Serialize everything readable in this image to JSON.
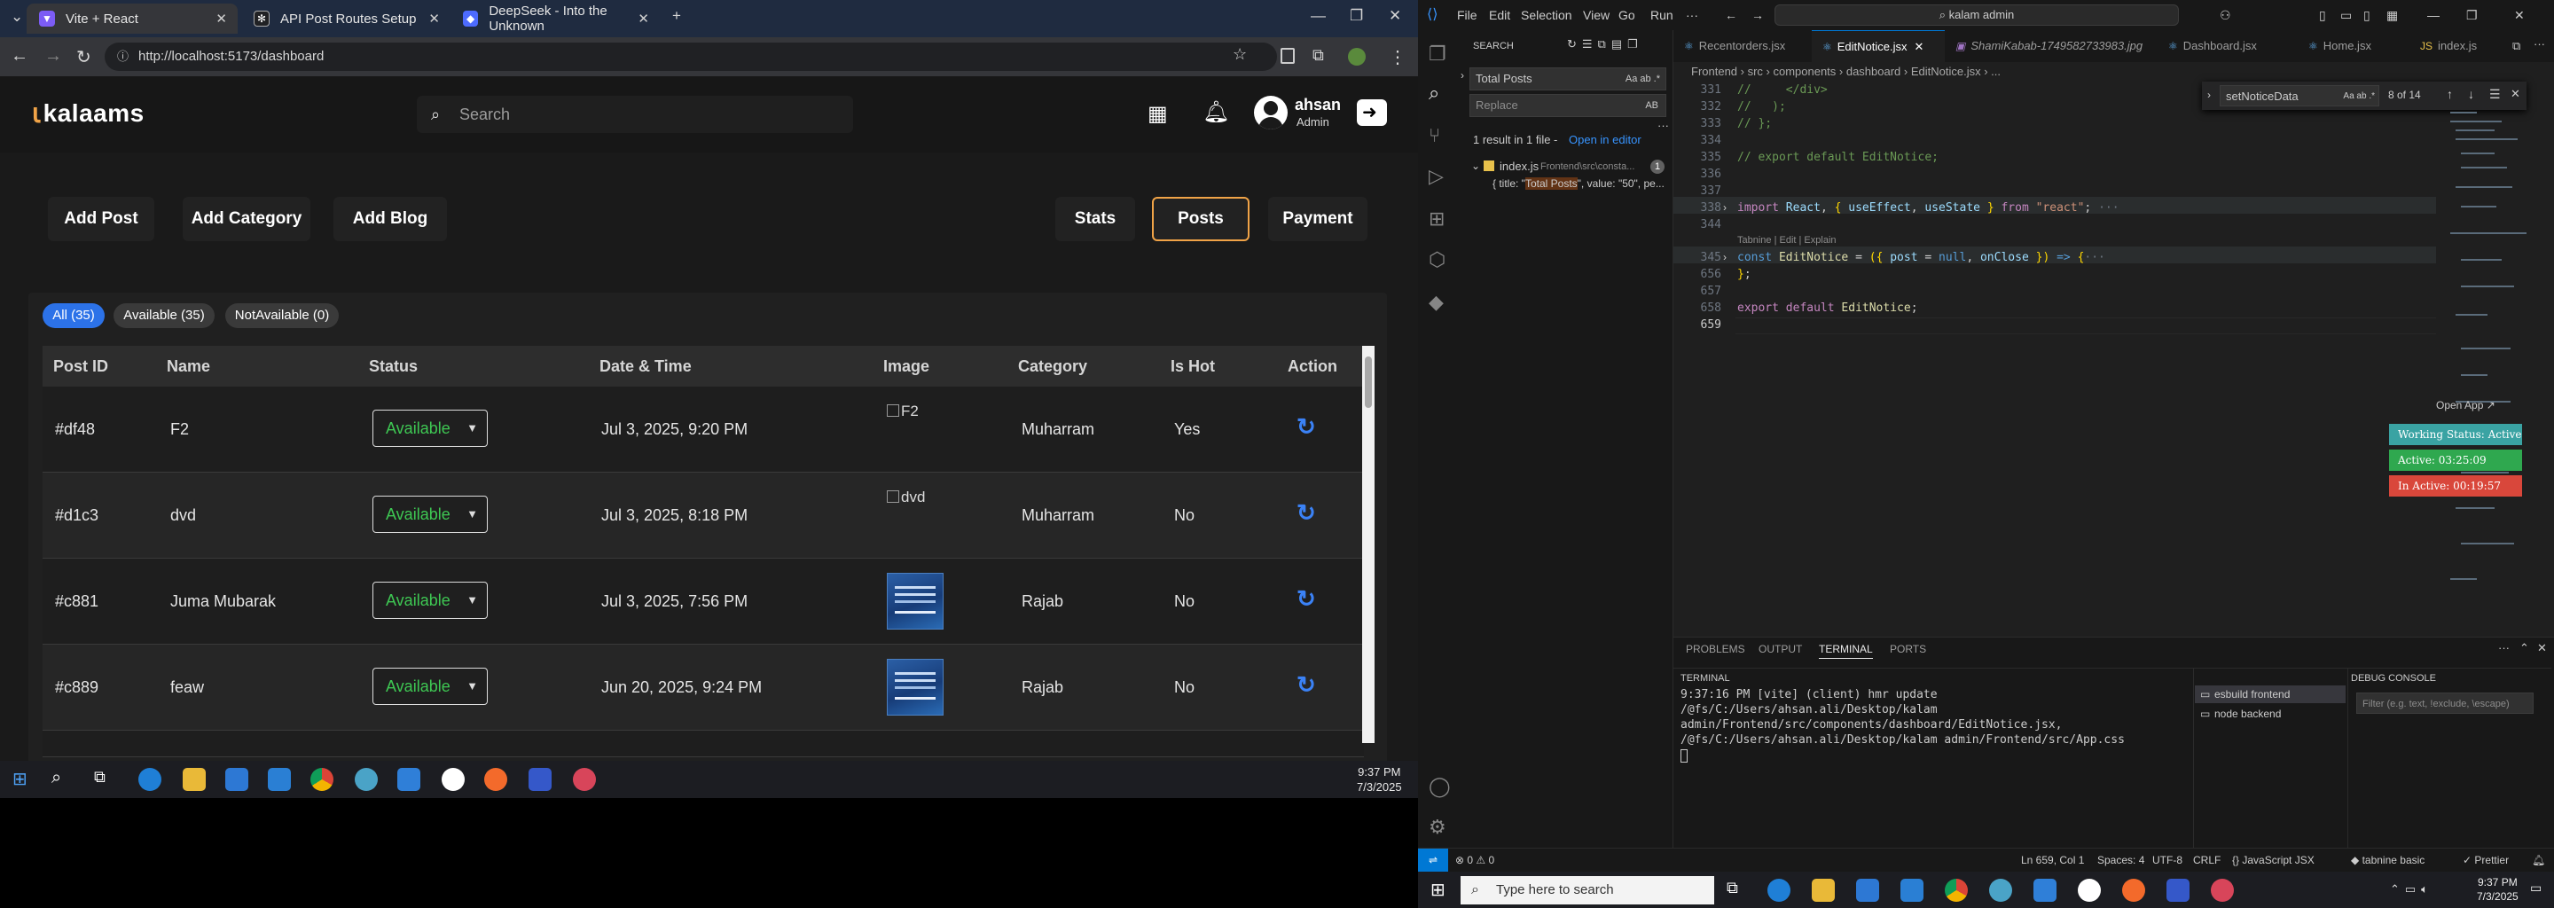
{
  "browser": {
    "tabs": [
      {
        "label": "Vite + React",
        "active": true
      },
      {
        "label": "API Post Routes Setup",
        "active": false
      },
      {
        "label": "DeepSeek - Into the Unknown",
        "active": false
      }
    ],
    "url": "http://localhost:5173/dashboard"
  },
  "app": {
    "logo": "kalaams",
    "search_placeholder": "Search",
    "user": {
      "name": "ahsan",
      "role": "Admin"
    },
    "actions": [
      "Add Post",
      "Add Category",
      "Add Blog"
    ],
    "tabs": [
      "Stats",
      "Posts",
      "Payment"
    ],
    "active_tab": "Posts",
    "filters": [
      {
        "label": "All (35)",
        "active": true
      },
      {
        "label": "Available (35)",
        "active": false
      },
      {
        "label": "NotAvailable (0)",
        "active": false
      }
    ],
    "columns": [
      "Post ID",
      "Name",
      "Status",
      "Date & Time",
      "Image",
      "Category",
      "Is Hot",
      "Action"
    ],
    "rows": [
      {
        "id": "#df48",
        "name": "F2",
        "status": "Available",
        "date": "Jul 3, 2025, 9:20 PM",
        "image_alt": "F2",
        "image_loaded": false,
        "category": "Muharram",
        "hot": "Yes"
      },
      {
        "id": "#d1c3",
        "name": "dvd",
        "status": "Available",
        "date": "Jul 3, 2025, 8:18 PM",
        "image_alt": "dvd",
        "image_loaded": false,
        "category": "Muharram",
        "hot": "No"
      },
      {
        "id": "#c881",
        "name": "Juma Mubarak",
        "status": "Available",
        "date": "Jul 3, 2025, 7:56 PM",
        "image_alt": "",
        "image_loaded": true,
        "category": "Rajab",
        "hot": "No"
      },
      {
        "id": "#c889",
        "name": "feaw",
        "status": "Available",
        "date": "Jun 20, 2025, 9:24 PM",
        "image_alt": "",
        "image_loaded": true,
        "category": "Rajab",
        "hot": "No"
      }
    ],
    "status_color": "#3ec853",
    "accent_color": "#f0a347",
    "filter_active_color": "#2c72e8"
  },
  "left_taskbar": {
    "time": "9:37 PM",
    "date": "7/3/2025"
  },
  "vscode": {
    "menu": [
      "File",
      "Edit",
      "Selection",
      "View",
      "Go",
      "Run",
      "···"
    ],
    "command_center": "kalam admin",
    "search": {
      "title": "SEARCH",
      "query": "Total Posts",
      "replace_placeholder": "Replace",
      "summary": "1 result in 1 file -",
      "open_in_editor": "Open in editor",
      "file": "index.js",
      "file_path": "Frontend\\src\\consta...",
      "file_count": "1",
      "match_prefix": "{ title: \"",
      "match": "Total Posts",
      "match_suffix": "\", value: \"50\", pe..."
    },
    "tabs": [
      {
        "label": "Recentorders.jsx",
        "active": false
      },
      {
        "label": "EditNotice.jsx",
        "active": true
      },
      {
        "label": "ShamiKabab-1749582733983.jpg",
        "active": false
      },
      {
        "label": "Dashboard.jsx",
        "active": false
      },
      {
        "label": "Home.jsx",
        "active": false
      },
      {
        "label": "index.js",
        "active": false
      }
    ],
    "breadcrumb": "Frontend › src › components › dashboard › EditNotice.jsx › ...",
    "find": {
      "query": "setNoticeData",
      "result": "8 of 14"
    },
    "code_lines": [
      {
        "n": "331",
        "text": "//     </div>"
      },
      {
        "n": "332",
        "text": "//   );"
      },
      {
        "n": "333",
        "text": "// };"
      },
      {
        "n": "334",
        "text": ""
      },
      {
        "n": "335",
        "text": "// export default EditNotice;"
      },
      {
        "n": "336",
        "text": ""
      },
      {
        "n": "337",
        "text": ""
      },
      {
        "n": "338",
        "text": "import React, { useEffect, useState } from \"react\";"
      },
      {
        "n": "344",
        "text": ""
      },
      {
        "n": "345",
        "text": "const EditNotice = ({ post = null, onClose }) => {"
      },
      {
        "n": "656",
        "text": "};"
      },
      {
        "n": "657",
        "text": ""
      },
      {
        "n": "658",
        "text": "export default EditNotice;"
      },
      {
        "n": "659",
        "text": ""
      }
    ],
    "codelens": "Tabnine | Edit | Explain",
    "open_app": "Open App ↗",
    "badges": [
      {
        "label": "Working Status: Active",
        "color": "#3aa3a3"
      },
      {
        "label": "Active: 03:25:09",
        "color": "#2fa84f"
      },
      {
        "label": "In Active: 00:19:57",
        "color": "#d9473b"
      }
    ],
    "panel_tabs": [
      "PROBLEMS",
      "OUTPUT",
      "TERMINAL",
      "PORTS"
    ],
    "terminal_title": "TERMINAL",
    "terminal_lines": [
      "9:37:16 PM [vite] (client) hmr update /@fs/C:/Users/ahsan.ali/Desktop/kalam admin/Frontend/src/components/dashboard/EditNotice.jsx, /@fs/C:/Users/ahsan.ali/Desktop/kalam admin/Frontend/src/App.css"
    ],
    "terminals": [
      "esbuild frontend",
      "node backend"
    ],
    "debug_console": "DEBUG CONSOLE",
    "debug_filter_placeholder": "Filter (e.g. text, !exclude, \\escape)",
    "status": {
      "errors": "⊗ 0  ⚠ 0",
      "position": "Ln 659, Col 1",
      "spaces": "Spaces: 4",
      "encoding": "UTF-8",
      "eol": "CRLF",
      "language": "{} JavaScript JSX",
      "tabnine": "◆ tabnine basic",
      "prettier": "✓ Prettier"
    }
  },
  "right_taskbar": {
    "search_placeholder": "Type here to search",
    "time": "9:37 PM",
    "date": "7/3/2025"
  }
}
